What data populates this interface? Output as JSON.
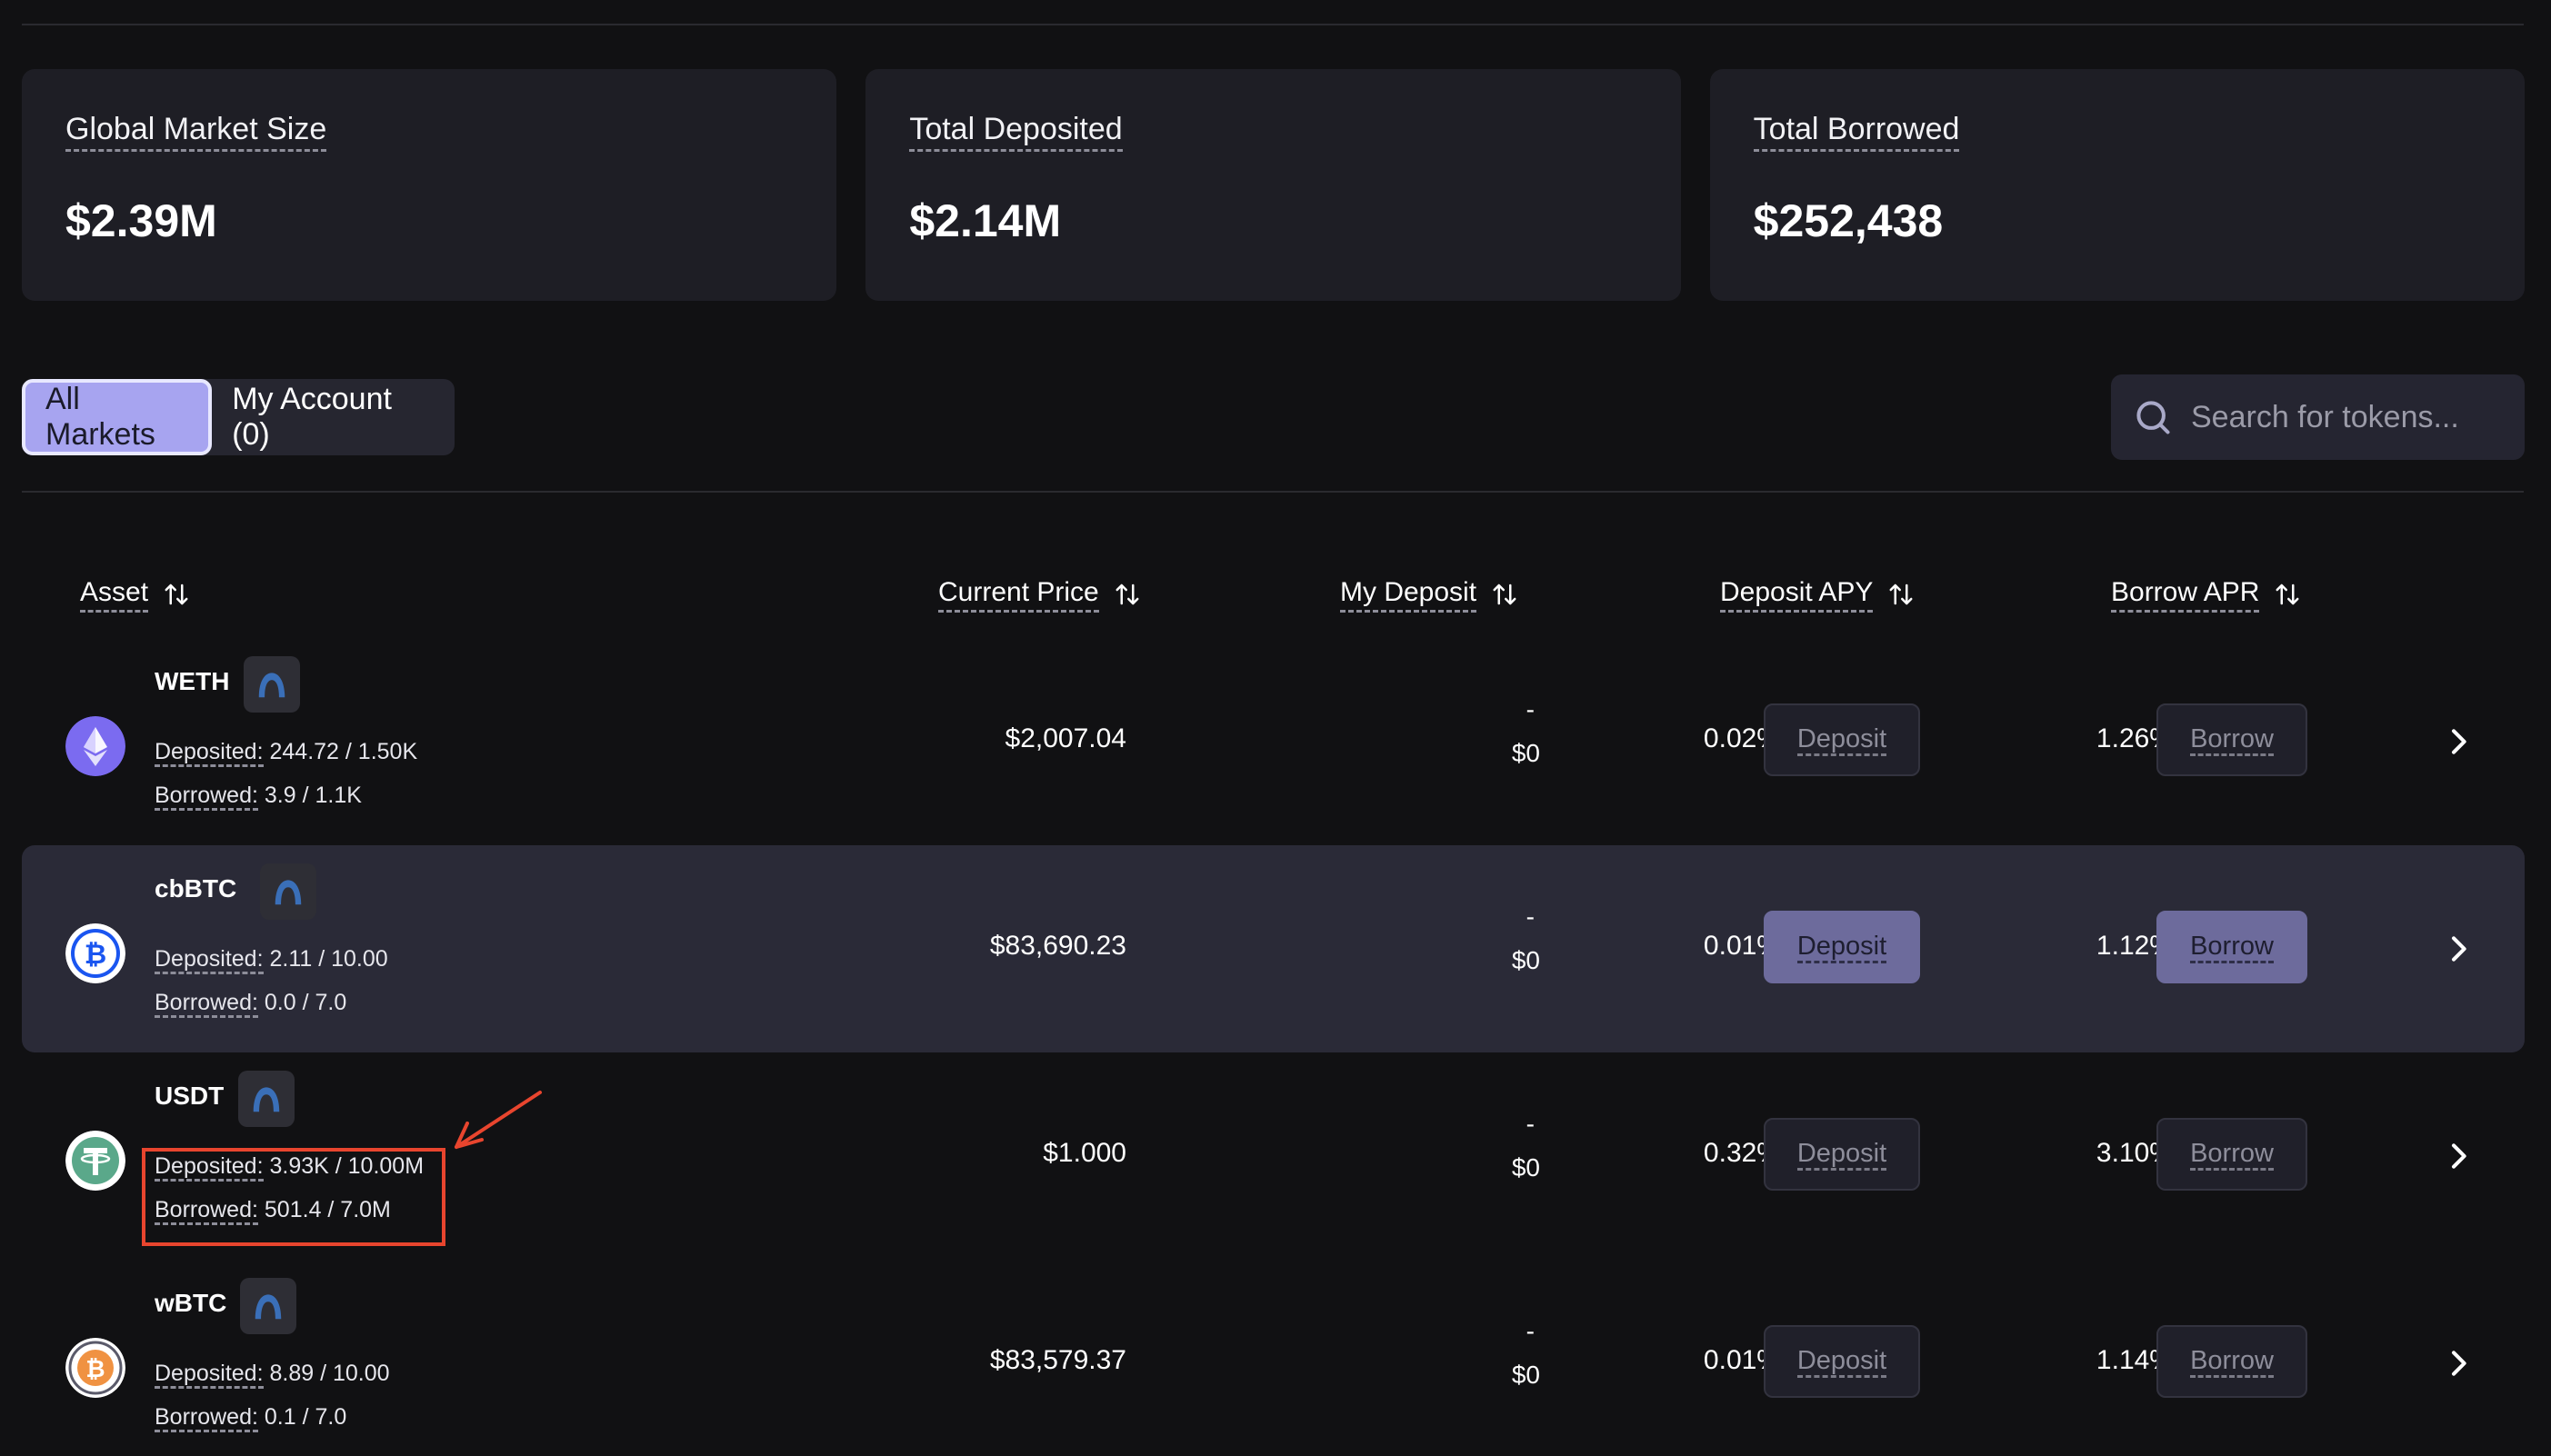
{
  "stats": [
    {
      "label": "Global Market Size",
      "value": "$2.39M"
    },
    {
      "label": "Total Deposited",
      "value": "$2.14M"
    },
    {
      "label": "Total Borrowed",
      "value": "$252,438"
    }
  ],
  "tabs": {
    "all_markets": "All Markets",
    "my_account": "My Account (0)"
  },
  "search": {
    "placeholder": "Search for tokens..."
  },
  "columns": {
    "asset": "Asset",
    "current_price": "Current Price",
    "my_deposit": "My Deposit",
    "deposit_apy": "Deposit APY",
    "borrow_apr": "Borrow APR"
  },
  "labels": {
    "deposited": "Deposited:",
    "borrowed": "Borrowed:",
    "deposit_button": "Deposit",
    "borrow_button": "Borrow"
  },
  "rows": [
    {
      "symbol": "WETH",
      "deposited": "244.72 / 1.50K",
      "borrowed": "3.9 / 1.1K",
      "price": "$2,007.04",
      "my_deposit_amount": "-",
      "my_deposit_value": "$0",
      "deposit_apy": "0.02%",
      "borrow_apr": "1.26%",
      "icon": "eth-icon",
      "color": "#7b6bf0"
    },
    {
      "symbol": "cbBTC",
      "deposited": "2.11 / 10.00",
      "borrowed": "0.0 / 7.0",
      "price": "$83,690.23",
      "my_deposit_amount": "-",
      "my_deposit_value": "$0",
      "deposit_apy": "0.01%",
      "borrow_apr": "1.12%",
      "icon": "cbbtc-icon",
      "color": "#1a55f0"
    },
    {
      "symbol": "USDT",
      "deposited": "3.93K / 10.00M",
      "borrowed": "501.4 / 7.0M",
      "price": "$1.000",
      "my_deposit_amount": "-",
      "my_deposit_value": "$0",
      "deposit_apy": "0.32%",
      "borrow_apr": "3.10%",
      "icon": "tether-icon",
      "color": "#5aa88a"
    },
    {
      "symbol": "wBTC",
      "deposited": "8.89 / 10.00",
      "borrowed": "0.1 / 7.0",
      "price": "$83,579.37",
      "my_deposit_amount": "-",
      "my_deposit_value": "$0",
      "deposit_apy": "0.01%",
      "borrow_apr": "1.14%",
      "icon": "wbtc-icon",
      "color": "#f09242"
    }
  ],
  "colors": {
    "background": "#111113",
    "card": "#1e1e25",
    "accent": "#a7a4f0",
    "annotation": "#e8452e"
  }
}
